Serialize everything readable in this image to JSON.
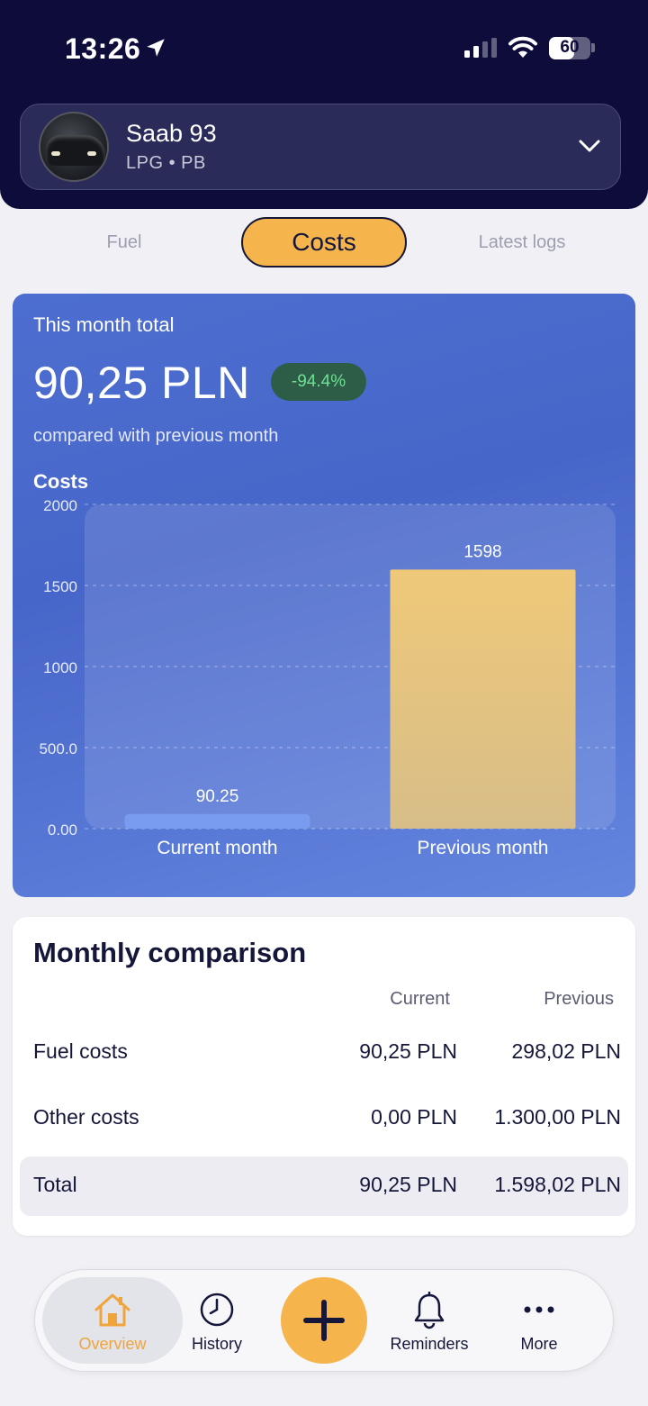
{
  "status_bar": {
    "time": "13:26",
    "battery": "60",
    "battery_level": 0.6
  },
  "vehicle": {
    "name": "Saab 93",
    "fuel_types": "LPG • PB"
  },
  "tabs": [
    {
      "label": "Fuel",
      "active": false
    },
    {
      "label": "Costs",
      "active": true
    },
    {
      "label": "Latest logs",
      "active": false
    }
  ],
  "summary": {
    "label": "This month total",
    "total": "90,25 PLN",
    "change": "-94.4%",
    "caption": "compared with previous month"
  },
  "chart_data": {
    "type": "bar",
    "title": "Costs",
    "categories": [
      "Current month",
      "Previous month"
    ],
    "values": [
      90.25,
      1598
    ],
    "value_labels": [
      "90.25",
      "1598"
    ],
    "ylim": [
      0,
      2000
    ],
    "yticks": [
      0,
      500,
      1000,
      1500,
      2000
    ],
    "ytick_labels": [
      "0.00",
      "500.0",
      "1000",
      "1500",
      "2000"
    ],
    "grid": true,
    "colors": [
      "#7a9cf0",
      "#ebc779"
    ]
  },
  "comparison": {
    "title": "Monthly comparison",
    "columns": [
      "Current",
      "Previous"
    ],
    "rows": [
      {
        "label": "Fuel costs",
        "current": "90,25 PLN",
        "previous": "298,02 PLN"
      },
      {
        "label": "Other costs",
        "current": "0,00 PLN",
        "previous": "1.300,00 PLN"
      },
      {
        "label": "Total",
        "current": "90,25 PLN",
        "previous": "1.598,02 PLN"
      }
    ]
  },
  "nav": {
    "overview": "Overview",
    "history": "History",
    "add_icon": "plus-icon",
    "reminders": "Reminders",
    "more": "More",
    "accent": "#f5b54c",
    "active_color": "#f0a53c"
  }
}
